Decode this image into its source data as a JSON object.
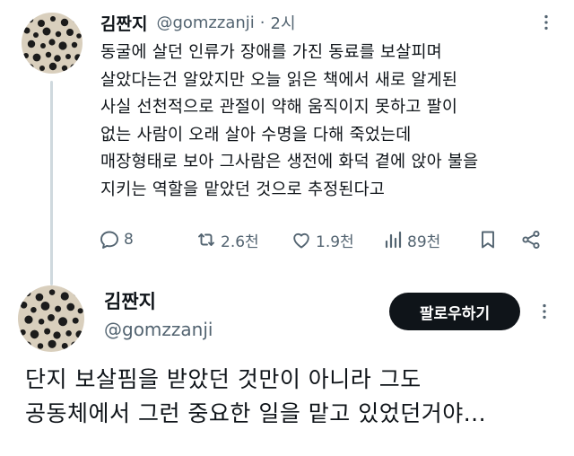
{
  "tweet": {
    "author_name": "김짠지",
    "author_handle": "@gomzzanji",
    "separator": "·",
    "time": "2시",
    "lines": [
      "동굴에 살던 인류가 장애를 가진 동료를 보살피며",
      "살았다는건 알았지만 오늘 읽은 책에서 새로 알게된",
      "사실 선천적으로 관절이 약해 움직이지 못하고 팔이",
      "없는 사람이 오래 살아 수명을 다해 죽었는데",
      "매장형태로 보아 그사람은 생전에 화덕 곁에 앉아 불을",
      "지키는 역할을 맡았던 것으로 추정된다고"
    ],
    "actions": {
      "reply_count": "8",
      "retweet_count": "2.6천",
      "like_count": "1.9천",
      "view_count": "89천"
    }
  },
  "reply": {
    "author_name": "김짠지",
    "author_handle": "@gomzzanji",
    "follow_label": "팔로우하기",
    "lines": [
      "단지 보살핌을 받았던 것만이 아니라 그도",
      "공동체에서 그런 중요한 일을 맡고 있었던거야..."
    ]
  },
  "icons": [
    "avatar",
    "more-icon",
    "reply-icon",
    "retweet-icon",
    "like-icon",
    "views-icon",
    "bookmark-icon",
    "share-icon"
  ],
  "colors": {
    "text": "#0f1419",
    "secondary": "#536471",
    "thread_line": "#cfd9de",
    "button_bg": "#0f1419"
  }
}
